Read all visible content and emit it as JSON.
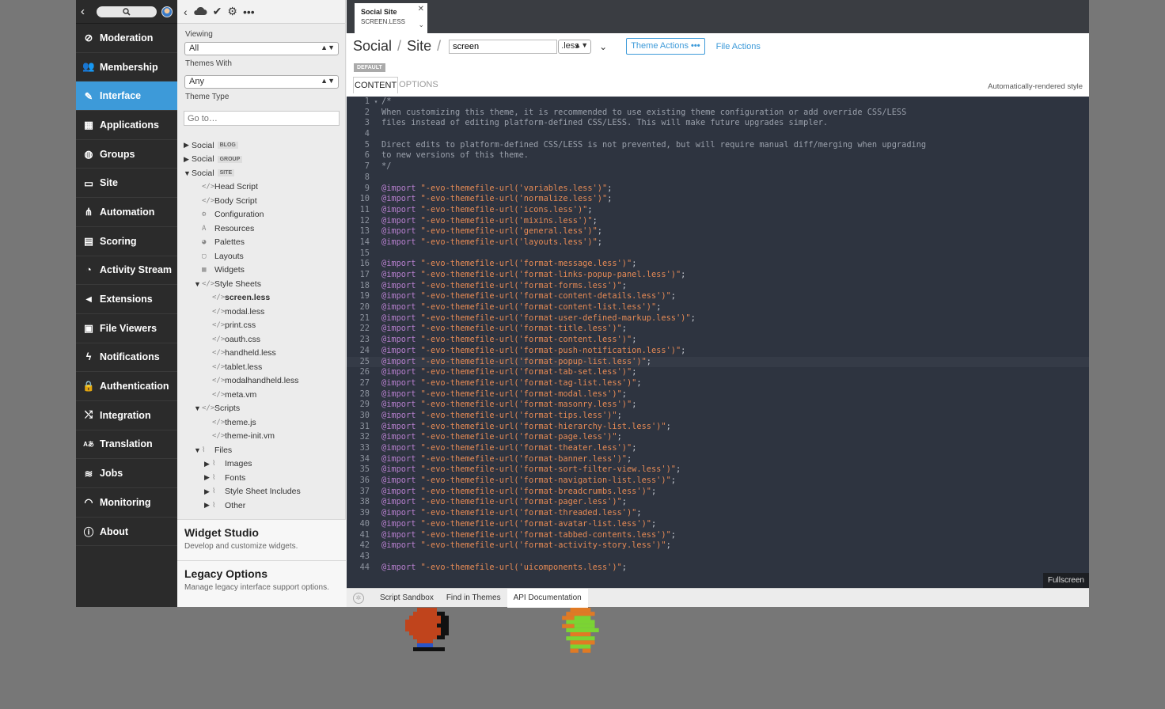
{
  "nav": {
    "items": [
      {
        "label": "Moderation",
        "icon": "block-icon"
      },
      {
        "label": "Membership",
        "icon": "users-icon"
      },
      {
        "label": "Interface",
        "icon": "brush-icon",
        "active": true
      },
      {
        "label": "Applications",
        "icon": "grid-icon"
      },
      {
        "label": "Groups",
        "icon": "globe-icon"
      },
      {
        "label": "Site",
        "icon": "window-icon"
      },
      {
        "label": "Automation",
        "icon": "network-icon"
      },
      {
        "label": "Scoring",
        "icon": "calculator-icon"
      },
      {
        "label": "Activity Stream",
        "icon": "compass-icon"
      },
      {
        "label": "Extensions",
        "icon": "megaphone-icon"
      },
      {
        "label": "File Viewers",
        "icon": "film-icon"
      },
      {
        "label": "Notifications",
        "icon": "bolt-icon"
      },
      {
        "label": "Authentication",
        "icon": "lock-icon"
      },
      {
        "label": "Integration",
        "icon": "shuffle-icon"
      },
      {
        "label": "Translation",
        "icon": "translate-icon"
      },
      {
        "label": "Jobs",
        "icon": "database-icon"
      },
      {
        "label": "Monitoring",
        "icon": "gauge-icon"
      },
      {
        "label": "About",
        "icon": "info-icon"
      }
    ]
  },
  "panel": {
    "viewing_label": "Viewing",
    "viewing_value": "All",
    "themes_with_label": "Themes With",
    "themes_with_value": "Any",
    "theme_type_label": "Theme Type",
    "goto_placeholder": "Go to…",
    "tree": [
      {
        "indent": 0,
        "tw": "▶",
        "icon": "",
        "label": "Social",
        "tag": "BLOG"
      },
      {
        "indent": 0,
        "tw": "▶",
        "icon": "",
        "label": "Social",
        "tag": "GROUP"
      },
      {
        "indent": 0,
        "tw": "▼",
        "icon": "",
        "label": "Social",
        "tag": "SITE"
      },
      {
        "indent": 1,
        "tw": "",
        "icon": "</>",
        "label": "Head Script"
      },
      {
        "indent": 1,
        "tw": "",
        "icon": "</>",
        "label": "Body Script"
      },
      {
        "indent": 1,
        "tw": "",
        "icon": "⚙",
        "label": "Configuration"
      },
      {
        "indent": 1,
        "tw": "",
        "icon": "A",
        "label": "Resources"
      },
      {
        "indent": 1,
        "tw": "",
        "icon": "◕",
        "label": "Palettes"
      },
      {
        "indent": 1,
        "tw": "",
        "icon": "▢",
        "label": "Layouts"
      },
      {
        "indent": 1,
        "tw": "",
        "icon": "▦",
        "label": "Widgets"
      },
      {
        "indent": 1,
        "tw": "▼",
        "icon": "</>",
        "label": "Style Sheets"
      },
      {
        "indent": 2,
        "tw": "",
        "icon": "</>",
        "label": "screen.less",
        "selected": true
      },
      {
        "indent": 2,
        "tw": "",
        "icon": "</>",
        "label": "modal.less"
      },
      {
        "indent": 2,
        "tw": "",
        "icon": "</>",
        "label": "print.css"
      },
      {
        "indent": 2,
        "tw": "",
        "icon": "</>",
        "label": "oauth.css"
      },
      {
        "indent": 2,
        "tw": "",
        "icon": "</>",
        "label": "handheld.less"
      },
      {
        "indent": 2,
        "tw": "",
        "icon": "</>",
        "label": "tablet.less"
      },
      {
        "indent": 2,
        "tw": "",
        "icon": "</>",
        "label": "modalhandheld.less"
      },
      {
        "indent": 2,
        "tw": "",
        "icon": "</>",
        "label": "meta.vm"
      },
      {
        "indent": 1,
        "tw": "▼",
        "icon": "</>",
        "label": "Scripts"
      },
      {
        "indent": 2,
        "tw": "",
        "icon": "</>",
        "label": "theme.js"
      },
      {
        "indent": 2,
        "tw": "",
        "icon": "</>",
        "label": "theme-init.vm"
      },
      {
        "indent": 1,
        "tw": "▼",
        "icon": "⌇",
        "label": "Files"
      },
      {
        "indent": 2,
        "tw": "▶",
        "icon": "⌇",
        "label": "Images"
      },
      {
        "indent": 2,
        "tw": "▶",
        "icon": "⌇",
        "label": "Fonts"
      },
      {
        "indent": 2,
        "tw": "▶",
        "icon": "⌇",
        "label": "Style Sheet Includes"
      },
      {
        "indent": 2,
        "tw": "▶",
        "icon": "⌇",
        "label": "Other"
      }
    ],
    "widget_studio": {
      "title": "Widget Studio",
      "subtitle": "Develop and customize widgets."
    },
    "legacy": {
      "title": "Legacy Options",
      "subtitle": "Manage legacy interface support options."
    }
  },
  "main": {
    "file_tab": {
      "name": "Social Site",
      "path": "SCREEN.LESS"
    },
    "crumb": {
      "a": "Social",
      "b": "Site"
    },
    "filename": "screen",
    "extension": ".less",
    "theme_actions": "Theme Actions",
    "file_actions": "File Actions",
    "badge": "DEFAULT",
    "tab_content": "CONTENT",
    "tab_options": "OPTIONS",
    "auto_style": "Automatically-rendered style",
    "fullscreen": "Fullscreen",
    "bottom_tabs": [
      "Script Sandbox",
      "Find in Themes",
      "API Documentation"
    ],
    "bottom_active": 2,
    "current_line": 25,
    "code": [
      "/*",
      "When customizing this theme, it is recommended to use existing theme configuration or add override CSS/LESS",
      "files instead of editing platform-defined CSS/LESS. This will make future upgrades simpler.",
      "",
      "Direct edits to platform-defined CSS/LESS is not prevented, but will require manual diff/merging when upgrading",
      "to new versions of this theme.",
      "*/",
      "",
      "@import \"-evo-themefile-url('variables.less')\";",
      "@import \"-evo-themefile-url('normalize.less')\";",
      "@import \"-evo-themefile-url('icons.less')\";",
      "@import \"-evo-themefile-url('mixins.less')\";",
      "@import \"-evo-themefile-url('general.less')\";",
      "@import \"-evo-themefile-url('layouts.less')\";",
      "",
      "@import \"-evo-themefile-url('format-message.less')\";",
      "@import \"-evo-themefile-url('format-links-popup-panel.less')\";",
      "@import \"-evo-themefile-url('format-forms.less')\";",
      "@import \"-evo-themefile-url('format-content-details.less')\";",
      "@import \"-evo-themefile-url('format-content-list.less')\";",
      "@import \"-evo-themefile-url('format-user-defined-markup.less')\";",
      "@import \"-evo-themefile-url('format-title.less')\";",
      "@import \"-evo-themefile-url('format-content.less')\";",
      "@import \"-evo-themefile-url('format-push-notification.less')\";",
      "@import \"-evo-themefile-url('format-popup-list.less')\";",
      "@import \"-evo-themefile-url('format-tab-set.less')\";",
      "@import \"-evo-themefile-url('format-tag-list.less')\";",
      "@import \"-evo-themefile-url('format-modal.less')\";",
      "@import \"-evo-themefile-url('format-masonry.less')\";",
      "@import \"-evo-themefile-url('format-tips.less')\";",
      "@import \"-evo-themefile-url('format-hierarchy-list.less')\";",
      "@import \"-evo-themefile-url('format-page.less')\";",
      "@import \"-evo-themefile-url('format-theater.less')\";",
      "@import \"-evo-themefile-url('format-banner.less')\";",
      "@import \"-evo-themefile-url('format-sort-filter-view.less')\";",
      "@import \"-evo-themefile-url('format-navigation-list.less')\";",
      "@import \"-evo-themefile-url('format-breadcrumbs.less')\";",
      "@import \"-evo-themefile-url('format-pager.less')\";",
      "@import \"-evo-themefile-url('format-threaded.less')\";",
      "@import \"-evo-themefile-url('format-avatar-list.less')\";",
      "@import \"-evo-themefile-url('format-tabbed-contents.less')\";",
      "@import \"-evo-themefile-url('format-activity-story.less')\";",
      "",
      "@import \"-evo-themefile-url('uicomponents.less')\";"
    ]
  },
  "colors": {
    "accent": "#3d9ad9",
    "nav_bg": "#2b2b2b",
    "editor_bg": "#2e3440",
    "keyword": "#b77fce",
    "string": "#e58a55"
  }
}
